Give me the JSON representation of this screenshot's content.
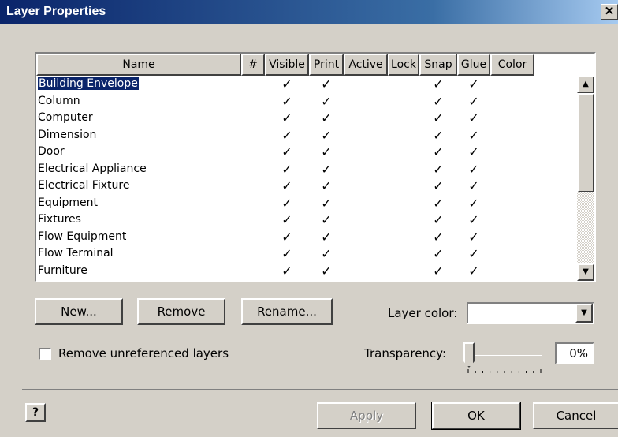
{
  "window": {
    "title": "Layer Properties",
    "close_glyph": "✕"
  },
  "columns": [
    "Name",
    "#",
    "Visible",
    "Print",
    "Active",
    "Lock",
    "Snap",
    "Glue",
    "Color"
  ],
  "layers": [
    {
      "name": "Building Envelope",
      "visible": true,
      "print": true,
      "active": false,
      "lock": false,
      "snap": true,
      "glue": true,
      "selected": true
    },
    {
      "name": "Column",
      "visible": true,
      "print": true,
      "active": false,
      "lock": false,
      "snap": true,
      "glue": true
    },
    {
      "name": "Computer",
      "visible": true,
      "print": true,
      "active": false,
      "lock": false,
      "snap": true,
      "glue": true
    },
    {
      "name": "Dimension",
      "visible": true,
      "print": true,
      "active": false,
      "lock": false,
      "snap": true,
      "glue": true
    },
    {
      "name": "Door",
      "visible": true,
      "print": true,
      "active": false,
      "lock": false,
      "snap": true,
      "glue": true
    },
    {
      "name": "Electrical Appliance",
      "visible": true,
      "print": true,
      "active": false,
      "lock": false,
      "snap": true,
      "glue": true
    },
    {
      "name": "Electrical Fixture",
      "visible": true,
      "print": true,
      "active": false,
      "lock": false,
      "snap": true,
      "glue": true
    },
    {
      "name": "Equipment",
      "visible": true,
      "print": true,
      "active": false,
      "lock": false,
      "snap": true,
      "glue": true
    },
    {
      "name": "Fixtures",
      "visible": true,
      "print": true,
      "active": false,
      "lock": false,
      "snap": true,
      "glue": true
    },
    {
      "name": "Flow Equipment",
      "visible": true,
      "print": true,
      "active": false,
      "lock": false,
      "snap": true,
      "glue": true
    },
    {
      "name": "Flow Terminal",
      "visible": true,
      "print": true,
      "active": false,
      "lock": false,
      "snap": true,
      "glue": true
    },
    {
      "name": "Furniture",
      "visible": true,
      "print": true,
      "active": false,
      "lock": false,
      "snap": true,
      "glue": true
    }
  ],
  "check_glyph": "✓",
  "buttons": {
    "new": "New...",
    "remove": "Remove",
    "rename": "Rename...",
    "apply": "Apply",
    "ok": "OK",
    "cancel": "Cancel"
  },
  "layer_color": {
    "label": "Layer color:",
    "value": ""
  },
  "remove_unreferenced": {
    "label": "Remove unreferenced layers",
    "checked": false
  },
  "transparency": {
    "label": "Transparency:",
    "value": "0%",
    "level": 0
  },
  "help_glyph": "?",
  "colors": {
    "face": "#d4d0c8",
    "title_start": "#0a246a",
    "title_end": "#a6caf0",
    "selection": "#0a246a"
  }
}
